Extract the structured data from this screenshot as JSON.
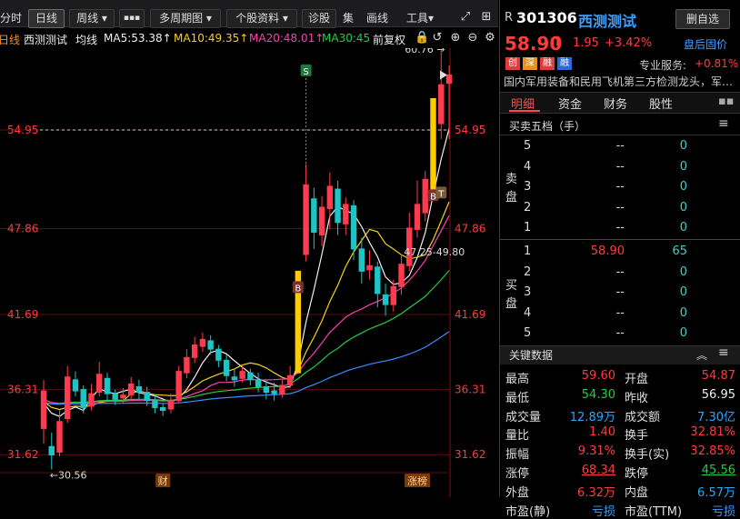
{
  "toolbar": {
    "fenshi": "分时",
    "rixian": "日线",
    "zhouxian": "周线 ▾",
    "more": "▪▪▪",
    "duozhouqi": "多周期图 ▾",
    "geguziliao": "个股资料 ▾",
    "zhengu": "诊股",
    "extra": "集",
    "huaxian": "画线",
    "gongju": "工具▾"
  },
  "info": {
    "period": "日线",
    "name": "西测测试",
    "junxian": "均线",
    "ma5": "MA5:53.38↑",
    "ma10": "MA10:49.35↑",
    "ma20": "MA20:48.01↑",
    "ma30": "MA30:45",
    "fuquan": "前复权"
  },
  "colors": {
    "up": "#ff3b4f",
    "down": "#1fc4c4",
    "ma5": "#f0f0f0",
    "ma10": "#f5d020",
    "ma20": "#ff40b0",
    "ma30": "#22cc44",
    "ma60": "#3a8cff"
  },
  "chart_data": {
    "type": "candlestick",
    "price_levels": [
      54.95,
      47.86,
      41.69,
      36.31,
      31.62
    ],
    "ylim": [
      30.0,
      62.0
    ],
    "reference_price": 54.95,
    "high_label": "60.76",
    "low_label": "30.56",
    "range_label": "47.25-49.80",
    "markers": [
      {
        "letter": "S",
        "bar": 33
      },
      {
        "letter": "B",
        "bar": 32
      },
      {
        "letter": "B",
        "bar": 49
      },
      {
        "letter": "T",
        "bar": 50
      }
    ],
    "bottom_labels": [
      {
        "text": "财",
        "bar": 15
      },
      {
        "text": "涨榜",
        "bar": 47
      }
    ],
    "candles": [
      [
        33.5,
        36.2,
        32.4,
        37.0
      ],
      [
        32.2,
        31.6,
        30.56,
        33.2
      ],
      [
        31.8,
        34.0,
        31.5,
        34.8
      ],
      [
        34.2,
        37.2,
        33.9,
        38.0
      ],
      [
        37.0,
        36.2,
        35.8,
        37.6
      ],
      [
        36.3,
        35.0,
        34.6,
        36.6
      ],
      [
        35.1,
        36.0,
        34.8,
        36.7
      ],
      [
        36.1,
        37.4,
        35.8,
        38.3
      ],
      [
        37.1,
        36.0,
        35.5,
        37.5
      ],
      [
        36.0,
        35.6,
        35.2,
        36.3
      ],
      [
        35.7,
        35.9,
        35.3,
        36.4
      ],
      [
        35.9,
        36.7,
        35.5,
        37.2
      ],
      [
        36.5,
        36.1,
        35.6,
        37.0
      ],
      [
        36.1,
        35.5,
        35.1,
        36.5
      ],
      [
        35.5,
        35.0,
        34.6,
        35.9
      ],
      [
        35.0,
        34.8,
        34.4,
        35.3
      ],
      [
        34.9,
        35.5,
        34.6,
        36.0
      ],
      [
        35.5,
        37.6,
        35.3,
        38.0
      ],
      [
        37.5,
        38.6,
        37.1,
        39.2
      ],
      [
        38.6,
        39.5,
        38.2,
        40.1
      ],
      [
        39.4,
        39.9,
        39.0,
        40.4
      ],
      [
        39.8,
        39.2,
        38.8,
        40.2
      ],
      [
        39.2,
        38.4,
        37.9,
        39.5
      ],
      [
        38.4,
        37.3,
        36.9,
        38.8
      ],
      [
        37.2,
        37.0,
        36.5,
        37.8
      ],
      [
        37.1,
        37.6,
        36.8,
        38.0
      ],
      [
        37.5,
        37.0,
        36.6,
        37.8
      ],
      [
        37.0,
        36.5,
        36.1,
        37.5
      ],
      [
        36.5,
        36.1,
        35.6,
        37.0
      ],
      [
        36.2,
        36.0,
        35.5,
        36.8
      ],
      [
        36.0,
        36.6,
        35.7,
        37.0
      ],
      [
        36.6,
        37.3,
        36.4,
        38.0
      ],
      [
        37.5,
        44.8,
        37.5,
        44.8
      ],
      [
        46.0,
        51.0,
        45.5,
        52.5
      ],
      [
        50.0,
        47.6,
        46.4,
        50.8
      ],
      [
        47.4,
        49.4,
        46.6,
        50.2
      ],
      [
        49.3,
        50.9,
        47.8,
        51.9
      ],
      [
        50.7,
        48.3,
        47.4,
        51.3
      ],
      [
        48.2,
        49.6,
        47.4,
        50.1
      ],
      [
        49.5,
        46.4,
        45.6,
        49.9
      ],
      [
        46.4,
        44.8,
        43.9,
        47.2
      ],
      [
        44.9,
        45.2,
        44.2,
        46.3
      ],
      [
        45.1,
        43.2,
        42.2,
        45.5
      ],
      [
        43.1,
        42.4,
        41.6,
        43.9
      ],
      [
        42.4,
        43.7,
        41.9,
        44.2
      ],
      [
        43.7,
        45.3,
        43.1,
        46.0
      ],
      [
        45.2,
        47.9,
        44.8,
        49.0
      ],
      [
        47.8,
        49.6,
        47.2,
        51.3
      ],
      [
        49.0,
        51.4,
        48.4,
        52.0
      ],
      [
        50.5,
        57.2,
        50.5,
        57.2
      ],
      [
        55.4,
        58.2,
        54.3,
        60.76
      ],
      [
        58.3,
        58.9,
        54.3,
        59.6
      ]
    ]
  },
  "quote": {
    "r": "R",
    "code": "301306",
    "name": "西测测试",
    "delself": "删自选",
    "price": "58.90",
    "arrow": "⬆",
    "change": "1.95",
    "pct": "+3.42%",
    "after": "盘后固价",
    "tag1": "创",
    "tag2": "深",
    "tag3": "融",
    "tag4": "融",
    "service": "专业服务:",
    "service_pct": "+0.81%",
    "desc": "国内军用装备和民用飞机第三方检测龙头，军…"
  },
  "tabs": [
    "明细",
    "资金",
    "财务",
    "股性"
  ],
  "ob_title": "买卖五档（手）",
  "sell": {
    "label1": "卖",
    "label2": "盘",
    "rows": [
      [
        "5",
        "--",
        "0"
      ],
      [
        "4",
        "--",
        "0"
      ],
      [
        "3",
        "--",
        "0"
      ],
      [
        "2",
        "--",
        "0"
      ],
      [
        "1",
        "--",
        "0"
      ]
    ]
  },
  "buy": {
    "label1": "买",
    "label2": "盘",
    "rows": [
      [
        "1",
        "58.90",
        "65"
      ],
      [
        "2",
        "--",
        "0"
      ],
      [
        "3",
        "--",
        "0"
      ],
      [
        "4",
        "--",
        "0"
      ],
      [
        "5",
        "--",
        "0"
      ]
    ]
  },
  "kd_title": "关键数据",
  "kd": [
    [
      "最高",
      "59.60",
      "开盘",
      "54.87"
    ],
    [
      "最低",
      "54.30",
      "昨收",
      "56.95"
    ],
    [
      "成交量",
      "12.89万",
      "成交额",
      "7.30亿"
    ],
    [
      "量比",
      "1.40",
      "换手",
      "32.81%"
    ],
    [
      "振幅",
      "9.31%",
      "换手(实)",
      "32.85%"
    ],
    [
      "涨停",
      "68.34",
      "跌停",
      "45.56"
    ],
    [
      "外盘",
      "6.32万",
      "内盘",
      "6.57万"
    ],
    [
      "市盈(静)",
      "亏损",
      "市盈(TTM)",
      "亏损"
    ]
  ]
}
